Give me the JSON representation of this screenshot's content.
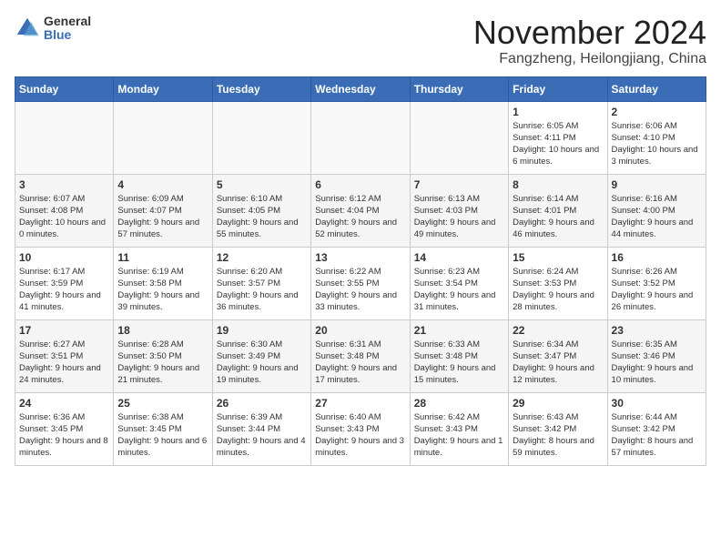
{
  "logo": {
    "general": "General",
    "blue": "Blue"
  },
  "title": "November 2024",
  "location": "Fangzheng, Heilongjiang, China",
  "days_of_week": [
    "Sunday",
    "Monday",
    "Tuesday",
    "Wednesday",
    "Thursday",
    "Friday",
    "Saturday"
  ],
  "weeks": [
    [
      {
        "day": "",
        "detail": ""
      },
      {
        "day": "",
        "detail": ""
      },
      {
        "day": "",
        "detail": ""
      },
      {
        "day": "",
        "detail": ""
      },
      {
        "day": "",
        "detail": ""
      },
      {
        "day": "1",
        "detail": "Sunrise: 6:05 AM\nSunset: 4:11 PM\nDaylight: 10 hours and 6 minutes."
      },
      {
        "day": "2",
        "detail": "Sunrise: 6:06 AM\nSunset: 4:10 PM\nDaylight: 10 hours and 3 minutes."
      }
    ],
    [
      {
        "day": "3",
        "detail": "Sunrise: 6:07 AM\nSunset: 4:08 PM\nDaylight: 10 hours and 0 minutes."
      },
      {
        "day": "4",
        "detail": "Sunrise: 6:09 AM\nSunset: 4:07 PM\nDaylight: 9 hours and 57 minutes."
      },
      {
        "day": "5",
        "detail": "Sunrise: 6:10 AM\nSunset: 4:05 PM\nDaylight: 9 hours and 55 minutes."
      },
      {
        "day": "6",
        "detail": "Sunrise: 6:12 AM\nSunset: 4:04 PM\nDaylight: 9 hours and 52 minutes."
      },
      {
        "day": "7",
        "detail": "Sunrise: 6:13 AM\nSunset: 4:03 PM\nDaylight: 9 hours and 49 minutes."
      },
      {
        "day": "8",
        "detail": "Sunrise: 6:14 AM\nSunset: 4:01 PM\nDaylight: 9 hours and 46 minutes."
      },
      {
        "day": "9",
        "detail": "Sunrise: 6:16 AM\nSunset: 4:00 PM\nDaylight: 9 hours and 44 minutes."
      }
    ],
    [
      {
        "day": "10",
        "detail": "Sunrise: 6:17 AM\nSunset: 3:59 PM\nDaylight: 9 hours and 41 minutes."
      },
      {
        "day": "11",
        "detail": "Sunrise: 6:19 AM\nSunset: 3:58 PM\nDaylight: 9 hours and 39 minutes."
      },
      {
        "day": "12",
        "detail": "Sunrise: 6:20 AM\nSunset: 3:57 PM\nDaylight: 9 hours and 36 minutes."
      },
      {
        "day": "13",
        "detail": "Sunrise: 6:22 AM\nSunset: 3:55 PM\nDaylight: 9 hours and 33 minutes."
      },
      {
        "day": "14",
        "detail": "Sunrise: 6:23 AM\nSunset: 3:54 PM\nDaylight: 9 hours and 31 minutes."
      },
      {
        "day": "15",
        "detail": "Sunrise: 6:24 AM\nSunset: 3:53 PM\nDaylight: 9 hours and 28 minutes."
      },
      {
        "day": "16",
        "detail": "Sunrise: 6:26 AM\nSunset: 3:52 PM\nDaylight: 9 hours and 26 minutes."
      }
    ],
    [
      {
        "day": "17",
        "detail": "Sunrise: 6:27 AM\nSunset: 3:51 PM\nDaylight: 9 hours and 24 minutes."
      },
      {
        "day": "18",
        "detail": "Sunrise: 6:28 AM\nSunset: 3:50 PM\nDaylight: 9 hours and 21 minutes."
      },
      {
        "day": "19",
        "detail": "Sunrise: 6:30 AM\nSunset: 3:49 PM\nDaylight: 9 hours and 19 minutes."
      },
      {
        "day": "20",
        "detail": "Sunrise: 6:31 AM\nSunset: 3:48 PM\nDaylight: 9 hours and 17 minutes."
      },
      {
        "day": "21",
        "detail": "Sunrise: 6:33 AM\nSunset: 3:48 PM\nDaylight: 9 hours and 15 minutes."
      },
      {
        "day": "22",
        "detail": "Sunrise: 6:34 AM\nSunset: 3:47 PM\nDaylight: 9 hours and 12 minutes."
      },
      {
        "day": "23",
        "detail": "Sunrise: 6:35 AM\nSunset: 3:46 PM\nDaylight: 9 hours and 10 minutes."
      }
    ],
    [
      {
        "day": "24",
        "detail": "Sunrise: 6:36 AM\nSunset: 3:45 PM\nDaylight: 9 hours and 8 minutes."
      },
      {
        "day": "25",
        "detail": "Sunrise: 6:38 AM\nSunset: 3:45 PM\nDaylight: 9 hours and 6 minutes."
      },
      {
        "day": "26",
        "detail": "Sunrise: 6:39 AM\nSunset: 3:44 PM\nDaylight: 9 hours and 4 minutes."
      },
      {
        "day": "27",
        "detail": "Sunrise: 6:40 AM\nSunset: 3:43 PM\nDaylight: 9 hours and 3 minutes."
      },
      {
        "day": "28",
        "detail": "Sunrise: 6:42 AM\nSunset: 3:43 PM\nDaylight: 9 hours and 1 minute."
      },
      {
        "day": "29",
        "detail": "Sunrise: 6:43 AM\nSunset: 3:42 PM\nDaylight: 8 hours and 59 minutes."
      },
      {
        "day": "30",
        "detail": "Sunrise: 6:44 AM\nSunset: 3:42 PM\nDaylight: 8 hours and 57 minutes."
      }
    ]
  ]
}
